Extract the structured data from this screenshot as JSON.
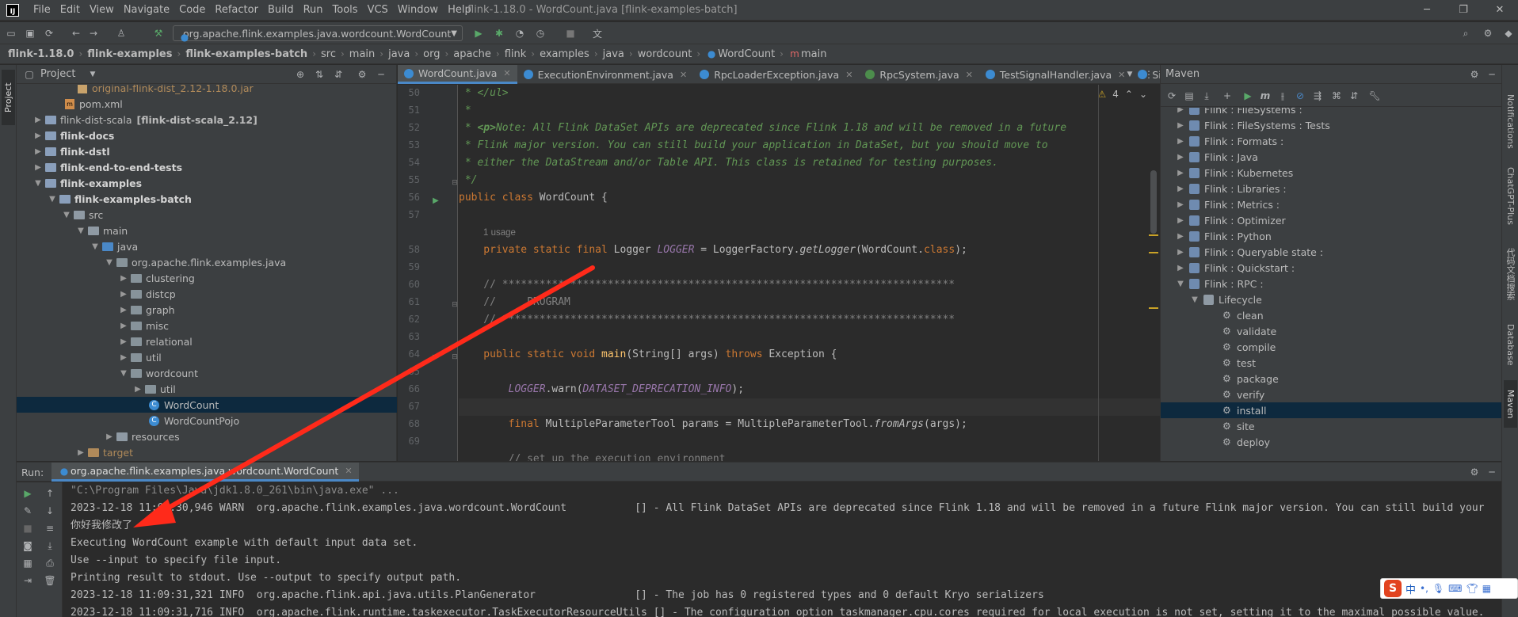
{
  "menubar": {
    "items": [
      "File",
      "Edit",
      "View",
      "Navigate",
      "Code",
      "Refactor",
      "Build",
      "Run",
      "Tools",
      "VCS",
      "Window",
      "Help"
    ],
    "window_title": "flink-1.18.0 - WordCount.java [flink-examples-batch]"
  },
  "toolbar": {
    "run_config": "org.apache.flink.examples.java.wordcount.WordCount"
  },
  "breadcrumb": [
    "flink-1.18.0",
    "flink-examples",
    "flink-examples-batch",
    "src",
    "main",
    "java",
    "org",
    "apache",
    "flink",
    "examples",
    "java",
    "wordcount",
    "WordCount",
    "main"
  ],
  "project": {
    "title": "Project",
    "side_label": "Project",
    "tree": [
      {
        "label": "original-flink-dist_2.12-1.18.0.jar",
        "type": "jar",
        "style": "excluded"
      },
      {
        "label": "pom.xml",
        "type": "xml"
      },
      {
        "label": "flink-dist-scala",
        "aux": "[flink-dist-scala_2.12]",
        "type": "module"
      },
      {
        "label": "flink-docs",
        "type": "module",
        "style": "bold"
      },
      {
        "label": "flink-dstl",
        "type": "module",
        "style": "bold"
      },
      {
        "label": "flink-end-to-end-tests",
        "type": "module",
        "style": "bold"
      },
      {
        "label": "flink-examples",
        "type": "module",
        "style": "bold"
      },
      {
        "label": "flink-examples-batch",
        "type": "module",
        "style": "bold"
      },
      {
        "label": "src",
        "type": "folder"
      },
      {
        "label": "main",
        "type": "folder"
      },
      {
        "label": "java",
        "type": "folder"
      },
      {
        "label": "org.apache.flink.examples.java",
        "type": "package"
      },
      {
        "label": "clustering",
        "type": "package"
      },
      {
        "label": "distcp",
        "type": "package"
      },
      {
        "label": "graph",
        "type": "package"
      },
      {
        "label": "misc",
        "type": "package"
      },
      {
        "label": "relational",
        "type": "package"
      },
      {
        "label": "util",
        "type": "package"
      },
      {
        "label": "wordcount",
        "type": "package"
      },
      {
        "label": "util",
        "type": "package"
      },
      {
        "label": "WordCount",
        "type": "class"
      },
      {
        "label": "WordCountPojo",
        "type": "class"
      },
      {
        "label": "resources",
        "type": "folder"
      },
      {
        "label": "target",
        "type": "folder",
        "style": "excluded"
      }
    ]
  },
  "editor": {
    "tabs": [
      "WordCount.java",
      "ExecutionEnvironment.java",
      "RpcLoaderException.java",
      "RpcSystem.java",
      "TestSignalHandler.java",
      "Sig"
    ],
    "warning_count": "4",
    "usage_hint": "1 usage",
    "line_numbers": [
      "50",
      "51",
      "52",
      "53",
      "54",
      "55",
      "56",
      "57",
      "",
      "58",
      "59",
      "60",
      "61",
      "62",
      "63",
      "64",
      "65",
      "66",
      "67",
      "68",
      "69"
    ],
    "code": {
      "l50": " * </ul>",
      "l51": " *",
      "l52a": " * ",
      "l52b": "<p>",
      "l52c": "Note: All Flink DataSet APIs are deprecated since Flink 1.18 and will be removed in a future",
      "l53": " * Flink major version. You can still build your application in DataSet, but you should move to",
      "l54": " * either the DataStream and/or Table API. This class is retained for testing purposes.",
      "l55": " */",
      "l56_kw": "public class",
      "l56_rest": " WordCount {",
      "l58_kw": "    private static final",
      "l58_a": " Logger ",
      "l58_f": "LOGGER",
      "l58_b": " = LoggerFactory.",
      "l58_m": "getLogger",
      "l58_c": "(WordCount.",
      "l58_k2": "class",
      "l58_d": ");",
      "l60": "    // *************************************************************************",
      "l61": "    //     PROGRAM",
      "l62": "    // *************************************************************************",
      "l64_kw": "    public static void",
      "l64_m": " main",
      "l64_a": "(String[] args) ",
      "l64_kw2": "throws",
      "l64_b": " Exception {",
      "l66_f": "        LOGGER",
      "l66_a": ".warn(",
      "l66_f2": "DATASET_DEPRECATION_INFO",
      "l66_b": ");",
      "l68_kw": "        final",
      "l68_a": " MultipleParameterTool params = MultipleParameterTool.",
      "l68_m": "fromArgs",
      "l68_b": "(args);",
      "l69": "        // set up the execution environment"
    }
  },
  "maven": {
    "title": "Maven",
    "modules": [
      "Flink : FileSystems :",
      "Flink : FileSystems : Tests",
      "Flink : Formats :",
      "Flink : Java",
      "Flink : Kubernetes",
      "Flink : Libraries :",
      "Flink : Metrics :",
      "Flink : Optimizer",
      "Flink : Python",
      "Flink : Queryable state :",
      "Flink : Quickstart :",
      "Flink : RPC :"
    ],
    "lifecycle_label": "Lifecycle",
    "lifecycle": [
      "clean",
      "validate",
      "compile",
      "test",
      "package",
      "verify",
      "install",
      "site",
      "deploy"
    ],
    "selected": "install"
  },
  "right_strip": [
    "Notifications",
    "ChatGPT-Plus",
    "代码文档搜索",
    "Database",
    "Maven"
  ],
  "run": {
    "label": "Run:",
    "tab": "org.apache.flink.examples.java.wordcount.WordCount",
    "lines": [
      "\"C:\\Program Files\\Java\\jdk1.8.0_261\\bin\\java.exe\" ...",
      "2023-12-18 11:09:30,946 WARN  org.apache.flink.examples.java.wordcount.WordCount           [] - All Flink DataSet APIs are deprecated since Flink 1.18 and will be removed in a future Flink major version. You can still build your",
      "你好我修改了",
      "Executing WordCount example with default input data set.",
      "Use --input to specify file input.",
      "Printing result to stdout. Use --output to specify output path.",
      "2023-12-18 11:09:31,321 INFO  org.apache.flink.api.java.utils.PlanGenerator                [] - The job has 0 registered types and 0 default Kryo serializers",
      "2023-12-18 11:09:31,716 INFO  org.apache.flink.runtime.taskexecutor.TaskExecutorResourceUtils [] - The configuration option taskmanager.cpu.cores required for local execution is not set, setting it to the maximal possible value."
    ]
  },
  "ime": {
    "logo": "S",
    "mode": "中"
  },
  "colors": {
    "accent": "#4a88c7",
    "selection": "#0d293e",
    "annotation_arrow": "#ff2a1a"
  }
}
